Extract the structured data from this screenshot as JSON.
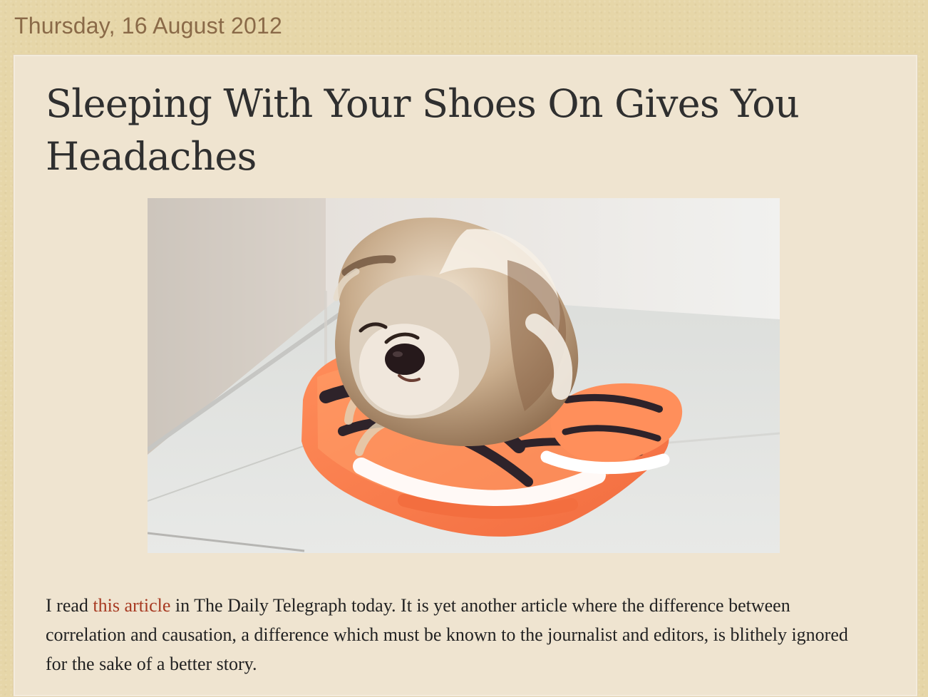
{
  "post": {
    "date": "Thursday, 16 August 2012",
    "title": "Sleeping With Your Shoes On Gives You Headaches",
    "image_alt": "Puppy sleeping on orange running shoes",
    "body_before_link": "I read ",
    "link_text": "this article",
    "body_after_link": " in The Daily Telegraph today. It is yet another article where the difference between correlation and causation, a difference which must be known to the journalist and editors, is blithely ignored for the sake of a better story."
  },
  "colors": {
    "page_background": "#e6d6a8",
    "panel_background": "#efe4d0",
    "date_text": "#8a6a48",
    "title_text": "#2f2f2f",
    "link": "#a73a22"
  }
}
